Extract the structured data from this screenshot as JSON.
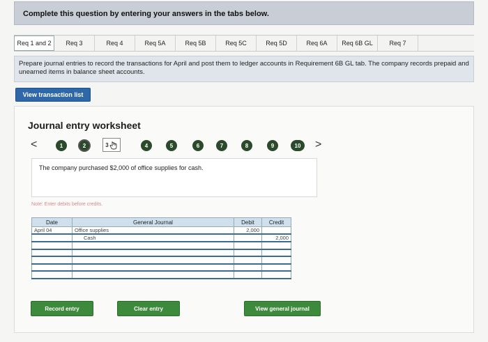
{
  "banner": "Complete this question by entering your answers in the tabs below.",
  "tabs": [
    "Req 1 and 2",
    "Req 3",
    "Req 4",
    "Req 5A",
    "Req 5B",
    "Req 5C",
    "Req 5D",
    "Req 6A",
    "Req 6B GL",
    "Req 7"
  ],
  "instruction": "Prepare journal entries to record the transactions for April and post them to ledger accounts in Requirement 6B GL tab. The company records prepaid and unearned items in balance sheet accounts.",
  "view_transaction_list": "View transaction list",
  "worksheet_title": "Journal entry worksheet",
  "nav": {
    "prev": "<",
    "next": ">"
  },
  "steps": [
    "1",
    "2",
    "3",
    "4",
    "5",
    "6",
    "7",
    "8",
    "9",
    "10"
  ],
  "transaction_text": "The company purchased $2,000 of office supplies for cash.",
  "note": "Note: Enter debits before credits.",
  "journal": {
    "headers": {
      "date": "Date",
      "general_journal": "General Journal",
      "debit": "Debit",
      "credit": "Credit"
    },
    "rows": [
      {
        "date": "April 04",
        "account": "Office supplies",
        "debit": "2,000",
        "credit": ""
      },
      {
        "date": "",
        "account": "Cash",
        "debit": "",
        "credit": "2,000"
      },
      {
        "date": "",
        "account": "",
        "debit": "",
        "credit": ""
      },
      {
        "date": "",
        "account": "",
        "debit": "",
        "credit": ""
      },
      {
        "date": "",
        "account": "",
        "debit": "",
        "credit": ""
      },
      {
        "date": "",
        "account": "",
        "debit": "",
        "credit": ""
      },
      {
        "date": "",
        "account": "",
        "debit": "",
        "credit": ""
      }
    ]
  },
  "buttons": {
    "record": "Record entry",
    "clear": "Clear entry",
    "view_general_journal": "View general journal"
  },
  "colors": {
    "banner_bg": "#c9ced6",
    "primary_blue": "#2f68a8",
    "step_green": "#2b4a2b",
    "button_green": "#3d8a3d"
  }
}
